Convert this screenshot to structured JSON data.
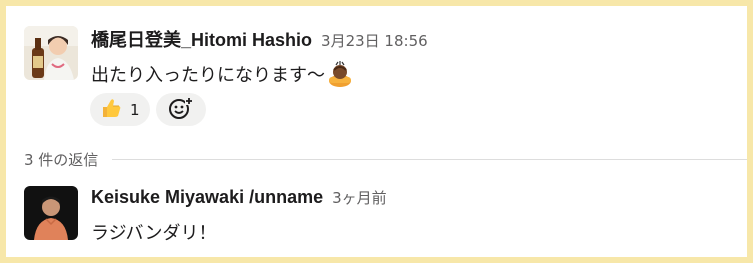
{
  "parent_message": {
    "author": "橋尾日登美_Hitomi Hashio",
    "timestamp": "3月23日 18:56",
    "text": "出たり入ったりになります〜",
    "trailing_emoji": "bowing-person-emoji",
    "reactions": [
      {
        "emoji": "thumbs-up-emoji",
        "count": "1"
      }
    ],
    "add_reaction_icon": "add-reaction-icon"
  },
  "thread": {
    "reply_count_label": "3 件の返信"
  },
  "reply": {
    "author": "Keisuke Miyawaki /unname",
    "timestamp": "3ヶ月前",
    "text": "ラジバンダリ！"
  },
  "colors": {
    "border": "#f7e7a9",
    "text_primary": "#1d1c1d",
    "text_secondary": "#616061",
    "reaction_bg": "#f1f1f0"
  }
}
